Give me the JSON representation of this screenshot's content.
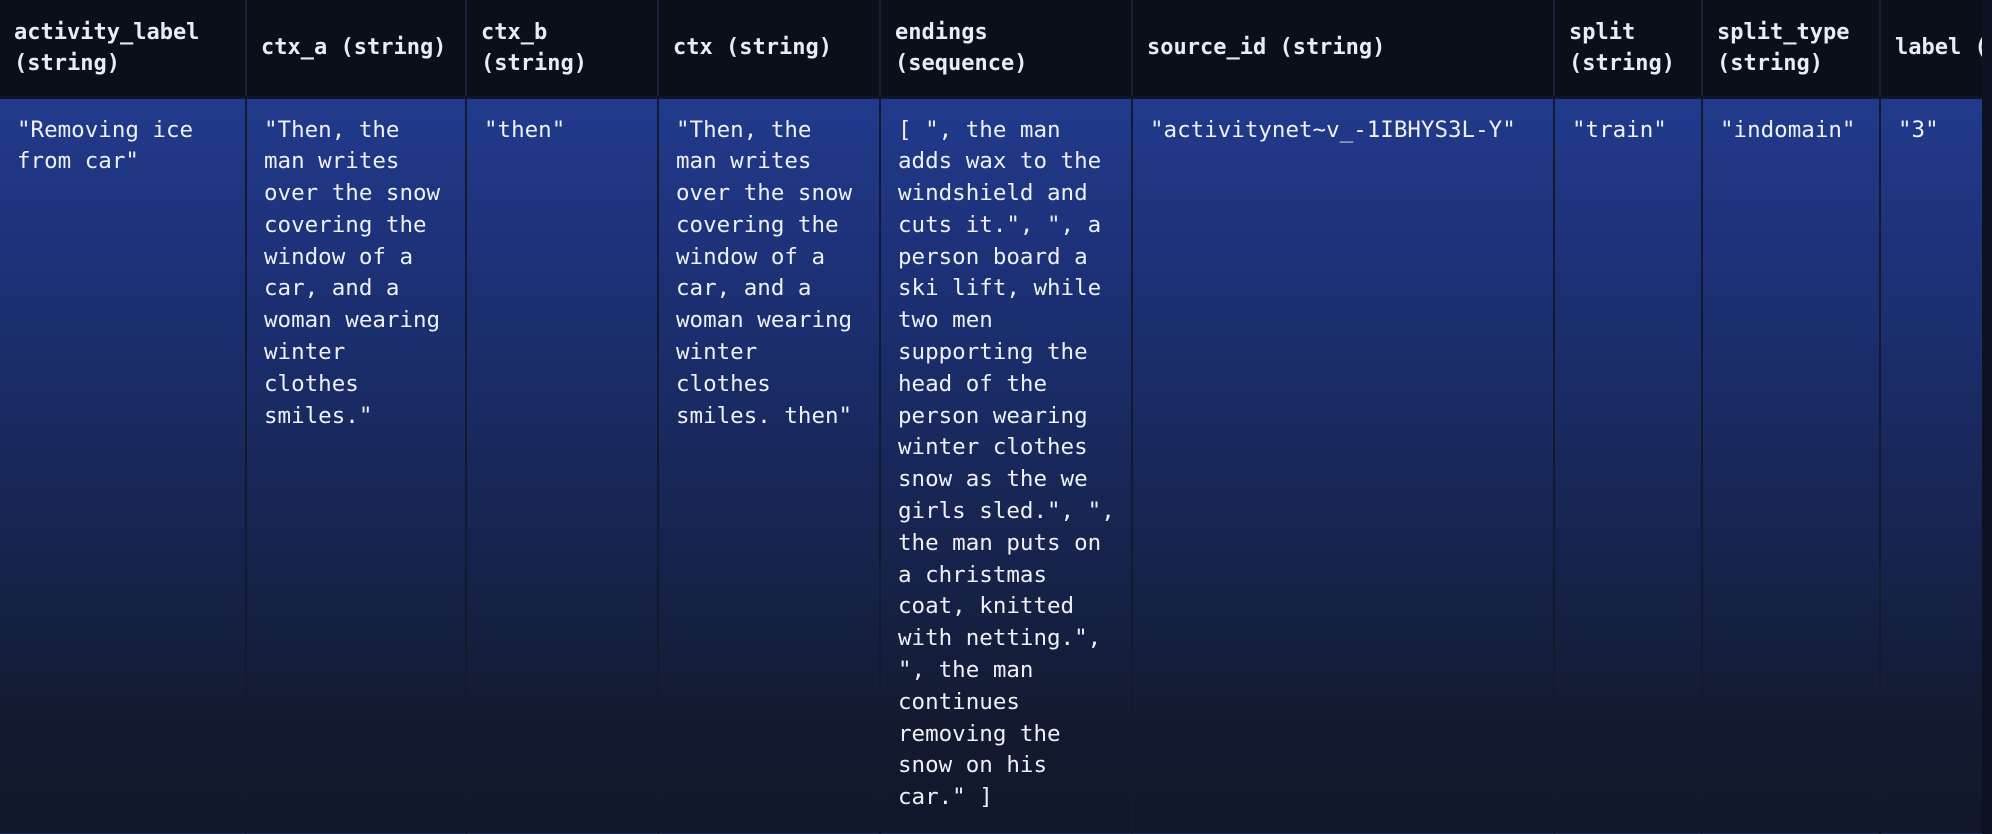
{
  "table": {
    "columns": [
      {
        "name": "activity_label",
        "type": "(string)",
        "header": "activity_label (string)"
      },
      {
        "name": "ctx_a",
        "type": "(string)",
        "header": "ctx_a (string)"
      },
      {
        "name": "ctx_b",
        "type": "(string)",
        "header": "ctx_b (string)"
      },
      {
        "name": "ctx",
        "type": "(string)",
        "header": "ctx (string)"
      },
      {
        "name": "endings",
        "type": "(sequence)",
        "header": "endings (sequence)"
      },
      {
        "name": "source_id",
        "type": "(string)",
        "header": "source_id (string)"
      },
      {
        "name": "split",
        "type": "(string)",
        "header": "split (string)"
      },
      {
        "name": "split_type",
        "type": "(string)",
        "header": "split_type (string)"
      },
      {
        "name": "label",
        "type": "(string)",
        "header": "label (string)"
      }
    ],
    "rows": [
      {
        "activity_label": "\"Removing ice from car\"",
        "ctx_a": "\"Then, the man writes over the snow covering the window of a car, and a woman wearing winter clothes smiles.\"",
        "ctx_b": "\"then\"",
        "ctx": "\"Then, the man writes over the snow covering the window of a car, and a woman wearing winter clothes smiles. then\"",
        "endings": "[ \", the man adds wax to the windshield and cuts it.\", \", a person board a ski lift, while two men supporting the head of the person wearing winter clothes snow as the we girls sled.\", \", the man puts on a christmas coat, knitted with netting.\", \", the man continues removing the snow on his car.\" ]",
        "source_id": "\"activitynet~v_-1IBHYS3L-Y\"",
        "split": "\"train\"",
        "split_type": "\"indomain\"",
        "label": "\"3\""
      }
    ]
  }
}
